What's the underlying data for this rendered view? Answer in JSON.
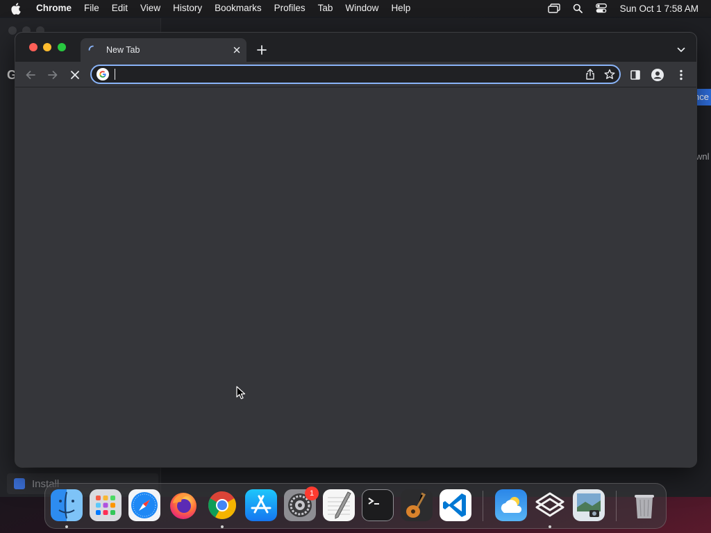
{
  "menubar": {
    "app_name": "Chrome",
    "items": [
      "File",
      "Edit",
      "View",
      "History",
      "Bookmarks",
      "Profiles",
      "Tab",
      "Window",
      "Help"
    ],
    "clock": "Sun Oct 1  7:58 AM"
  },
  "background": {
    "install_label": "Install",
    "blue_button_fragment": "nce",
    "download_fragment": "wnl"
  },
  "browser": {
    "tab": {
      "title": "New Tab",
      "loading": true
    },
    "omnibox": {
      "value": "",
      "search_engine_icon": "google-g-icon"
    },
    "colors": {
      "frame": "#202124",
      "toolbar": "#35363a",
      "omnibox_focus": "#8ab4f8"
    }
  },
  "dock": {
    "apps": [
      {
        "name": "Finder",
        "icon": "finder-icon",
        "running": true
      },
      {
        "name": "Launchpad",
        "icon": "launchpad-icon",
        "running": false
      },
      {
        "name": "Safari",
        "icon": "safari-icon",
        "running": false
      },
      {
        "name": "Firefox",
        "icon": "firefox-icon",
        "running": false
      },
      {
        "name": "Google Chrome",
        "icon": "chrome-icon",
        "running": true
      },
      {
        "name": "App Store",
        "icon": "app-store-icon",
        "running": false
      },
      {
        "name": "System Settings",
        "icon": "system-settings-icon",
        "running": false,
        "badge": "1"
      },
      {
        "name": "TextEdit",
        "icon": "textedit-icon",
        "running": false
      },
      {
        "name": "Terminal",
        "icon": "terminal-icon",
        "running": false
      },
      {
        "name": "GarageBand",
        "icon": "garageband-icon",
        "running": false
      },
      {
        "name": "Visual Studio Code",
        "icon": "vscode-icon",
        "running": false
      },
      {
        "name": "Weather",
        "icon": "weather-icon",
        "running": false
      },
      {
        "name": "Installer",
        "icon": "installer-icon",
        "running": true
      },
      {
        "name": "Preview",
        "icon": "preview-icon",
        "running": false
      },
      {
        "name": "Trash",
        "icon": "trash-icon",
        "running": false
      }
    ]
  }
}
